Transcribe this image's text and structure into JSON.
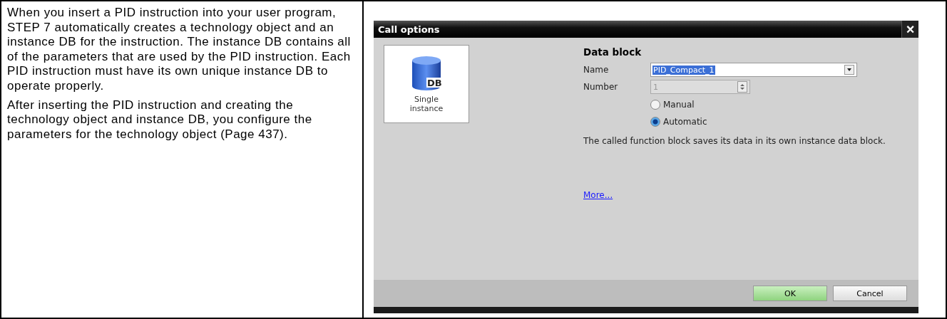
{
  "document": {
    "paragraphs": [
      "When you insert a PID instruction into your user program, STEP 7 automatically creates a technology object and an instance DB for the instruction. The instance DB contains all of the parameters that are used by the PID instruction. Each PID instruction must have its own unique instance DB to operate properly.",
      "After inserting the PID instruction and creating the technology object and instance DB, you configure the parameters for the technology object (Page 437)."
    ]
  },
  "dialog": {
    "title": "Call options",
    "close": "×",
    "tiles": [
      {
        "label": "Single instance",
        "icon_text": "DB",
        "selected": true
      }
    ],
    "section": "Data block",
    "fields": [
      {
        "kind": "combo",
        "label": "Name",
        "value": "PID_Compact_1",
        "disabled": false
      },
      {
        "kind": "spin",
        "label": "Number",
        "value": "1",
        "disabled": true
      }
    ],
    "radios": [
      {
        "label": "Manual",
        "selected": false
      },
      {
        "label": "Automatic",
        "selected": true
      }
    ],
    "description": "The called function block saves its data in its own instance data block.",
    "link": "More...",
    "buttons": [
      {
        "label": "OK",
        "kind": "primary"
      },
      {
        "label": "Cancel",
        "kind": "secondary"
      }
    ]
  }
}
